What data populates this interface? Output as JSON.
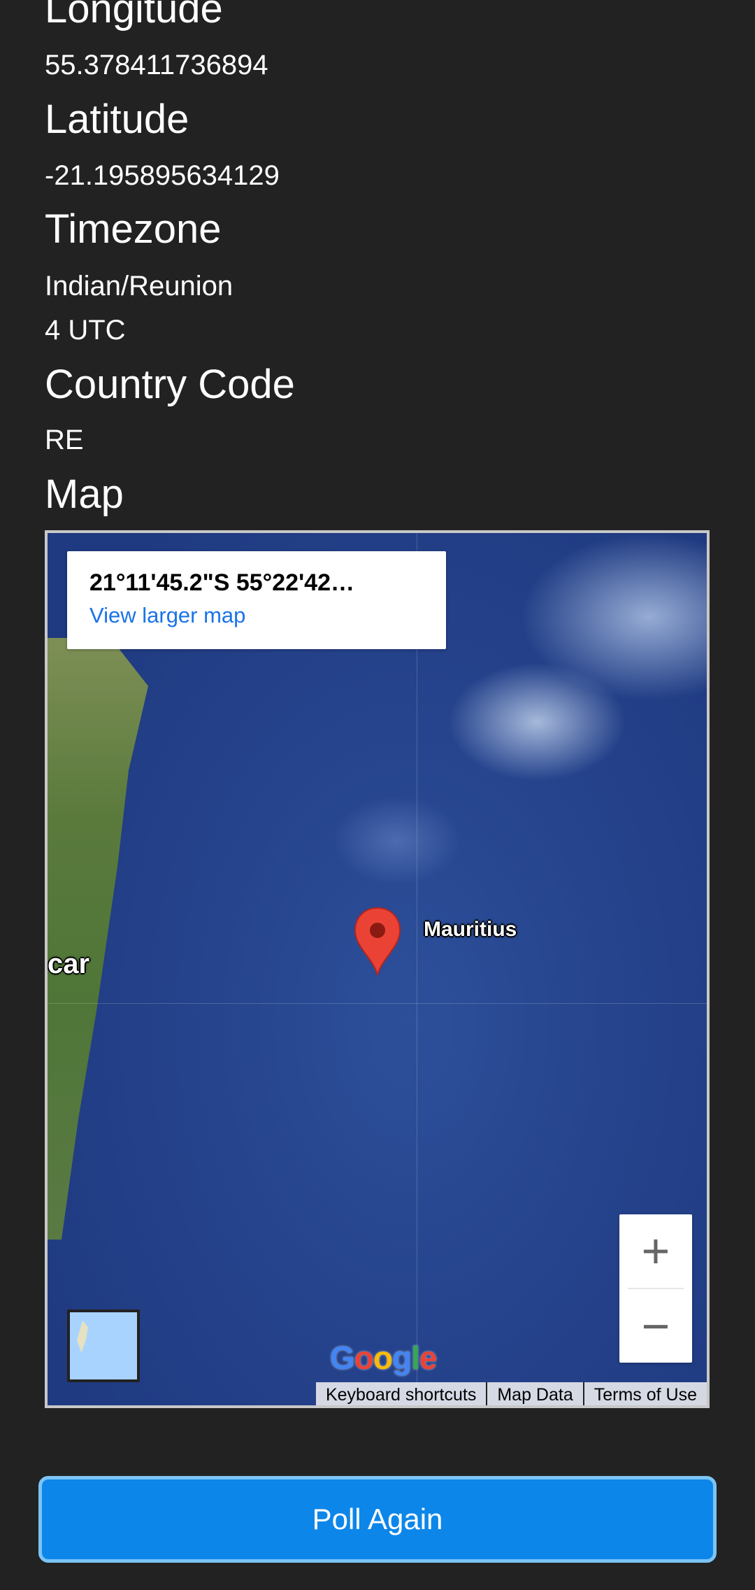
{
  "sections": {
    "longitude": {
      "heading": "Longitude",
      "value": "55.378411736894"
    },
    "latitude": {
      "heading": "Latitude",
      "value": "-21.195895634129"
    },
    "timezone": {
      "heading": "Timezone",
      "name": "Indian/Reunion",
      "offset": "4 UTC"
    },
    "country_code": {
      "heading": "Country Code",
      "value": "RE"
    },
    "map": {
      "heading": "Map"
    }
  },
  "map": {
    "info_coordinates": "21°11'45.2\"S 55°22'42…",
    "view_larger_label": "View larger map",
    "place_labels": {
      "mauritius": "Mauritius",
      "madagascar_partial": "car"
    },
    "zoom_in": "+",
    "zoom_out": "−",
    "logo_letters": [
      "G",
      "o",
      "o",
      "g",
      "l",
      "e"
    ],
    "attribution": {
      "keyboard_shortcuts": "Keyboard shortcuts",
      "map_data": "Map Data",
      "terms": "Terms of Use"
    },
    "marker_color": "#ea4335",
    "water_color": "#24418a"
  },
  "actions": {
    "poll_label": "Poll Again"
  },
  "colors": {
    "background": "#222222",
    "primary_button": "#0d86e9"
  }
}
